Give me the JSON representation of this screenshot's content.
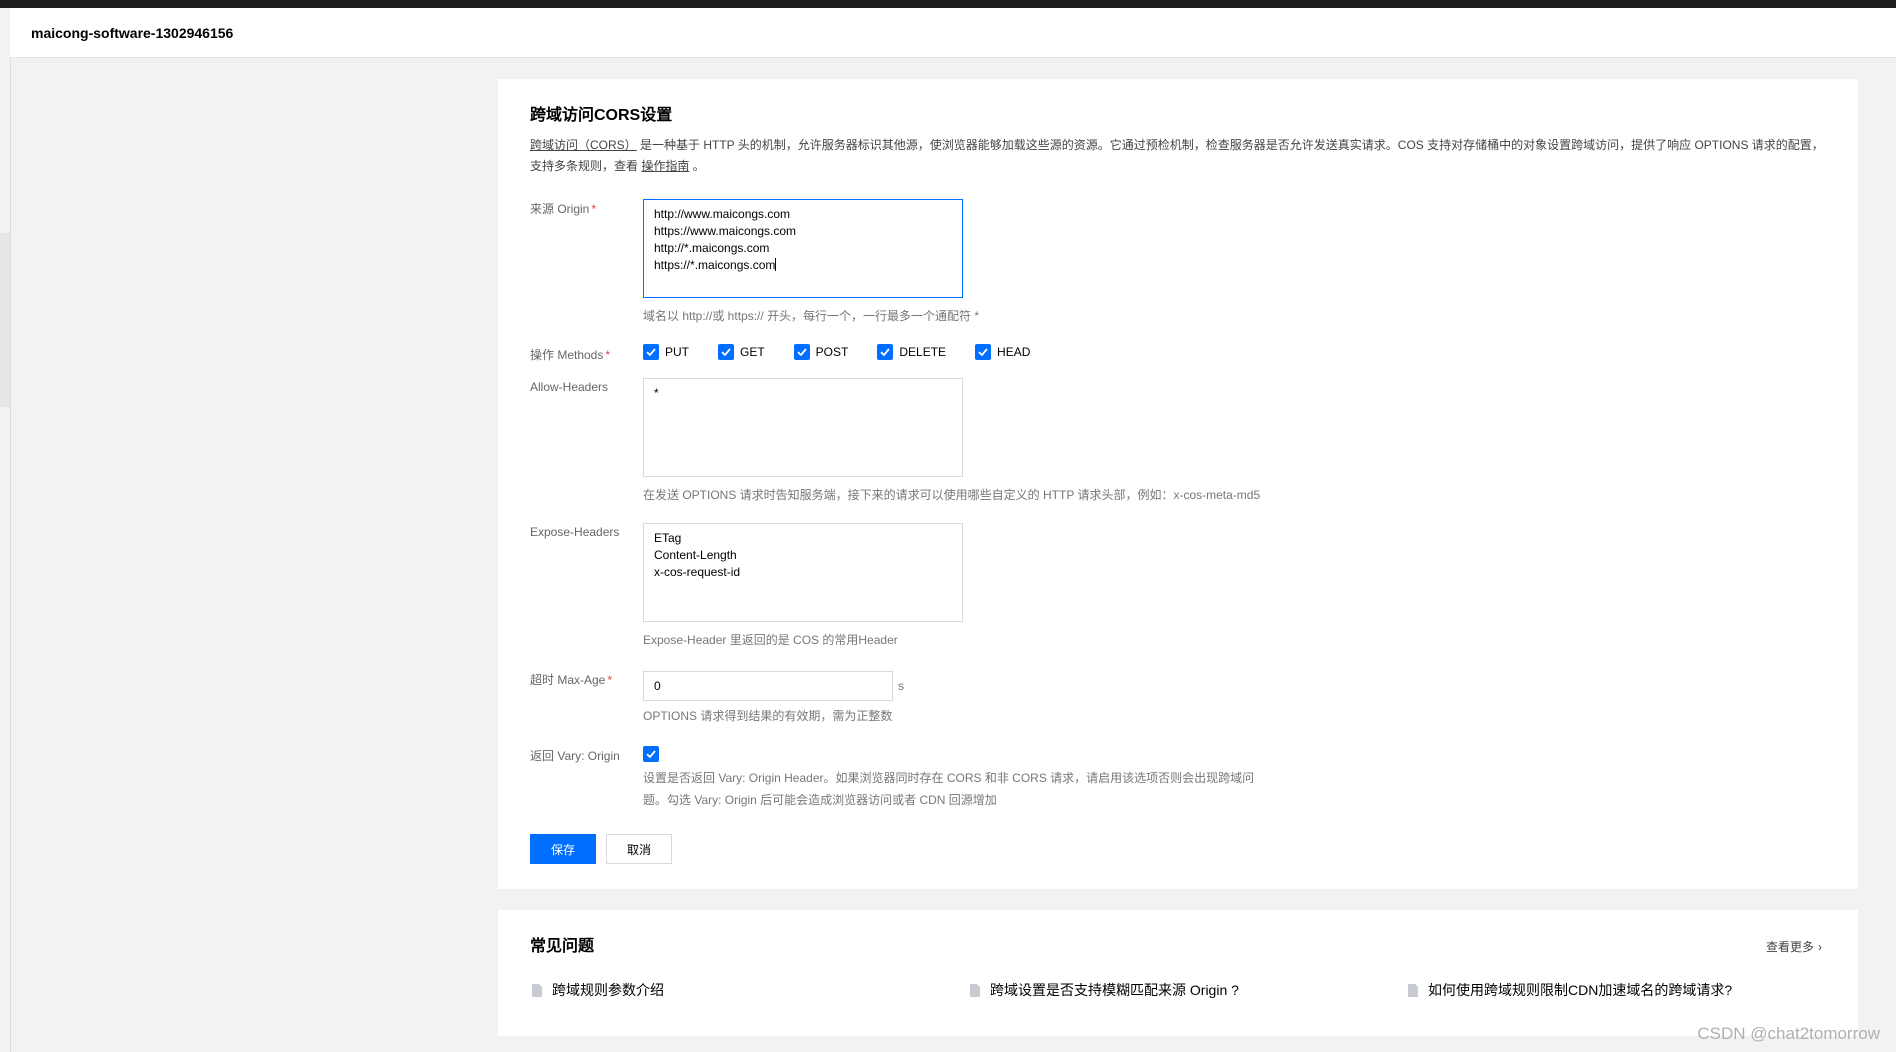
{
  "header": {
    "bucket_name": "maicong-software-1302946156"
  },
  "cors": {
    "title": "跨域访问CORS设置",
    "desc_link1": "跨域访问（CORS）",
    "desc_text1": " 是一种基于 HTTP 头的机制，允许服务器标识其他源，使浏览器能够加载这些源的资源。它通过预检机制，检查服务器是否允许发送真实请求。COS 支持对存储桶中的对象设置跨域访问，提供了响应 OPTIONS 请求的配置，支持多条规则，查看 ",
    "desc_link2": "操作指南",
    "desc_text2": " 。",
    "origin": {
      "label": "来源 Origin",
      "required": "*",
      "lines": [
        "http://www.maicongs.com",
        "https://www.maicongs.com",
        "http://*.maicongs.com",
        "https://*.maicongs.com"
      ],
      "help": "域名以 http://或 https:// 开头，每行一个，一行最多一个通配符 *"
    },
    "methods": {
      "label": "操作 Methods",
      "required": "*",
      "items": [
        {
          "label": "PUT",
          "checked": true
        },
        {
          "label": "GET",
          "checked": true
        },
        {
          "label": "POST",
          "checked": true
        },
        {
          "label": "DELETE",
          "checked": true
        },
        {
          "label": "HEAD",
          "checked": true
        }
      ]
    },
    "allow_headers": {
      "label": "Allow-Headers",
      "value": "*",
      "help": "在发送 OPTIONS 请求时告知服务端，接下来的请求可以使用哪些自定义的 HTTP 请求头部，例如：x-cos-meta-md5"
    },
    "expose_headers": {
      "label": "Expose-Headers",
      "lines": [
        "ETag",
        "Content-Length",
        "x-cos-request-id"
      ],
      "help": "Expose-Header 里返回的是 COS 的常用Header"
    },
    "max_age": {
      "label": "超时 Max-Age",
      "required": "*",
      "value": "0",
      "unit": "s",
      "help": "OPTIONS 请求得到结果的有效期，需为正整数"
    },
    "vary": {
      "label": "返回 Vary: Origin",
      "checked": true,
      "help_line1": "设置是否返回 Vary: Origin Header。如果浏览器同时存在 CORS 和非 CORS 请求，请启用该选项否则会出现跨域问",
      "help_line2": "题。勾选 Vary: Origin 后可能会造成浏览器访问或者 CDN 回源增加"
    },
    "save_label": "保存",
    "cancel_label": "取消"
  },
  "faq": {
    "title": "常见问题",
    "more_label": "查看更多",
    "items": [
      {
        "label": "跨域规则参数介绍"
      },
      {
        "label": "跨域设置是否支持模糊匹配来源 Origin ?"
      },
      {
        "label": "如何使用跨域规则限制CDN加速域名的跨域请求?"
      }
    ]
  },
  "watermark": "CSDN @chat2tomorrow",
  "colors": {
    "accent": "#006eff",
    "required": "#e54545"
  }
}
